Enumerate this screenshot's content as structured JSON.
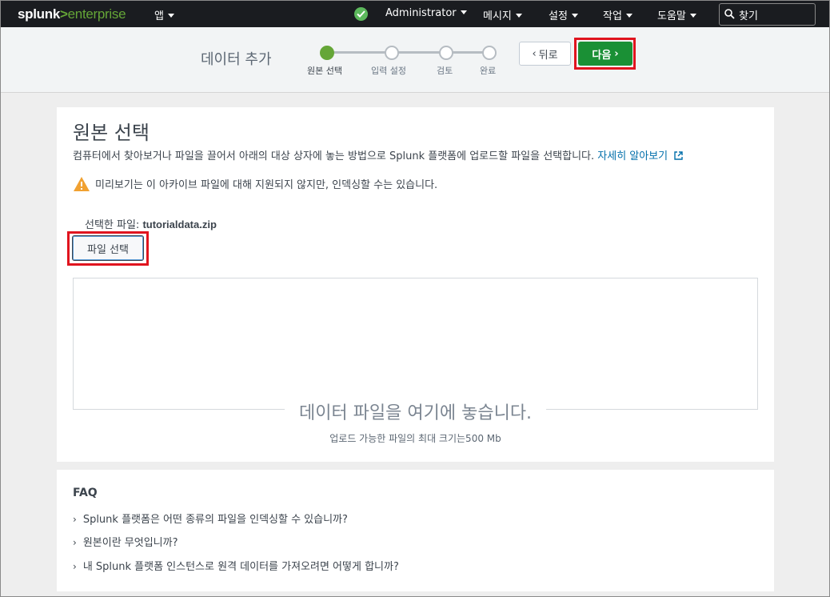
{
  "topbar": {
    "logo_part1": "splunk",
    "logo_part2": ">",
    "logo_part3": "enterprise",
    "apps_label": "앱",
    "user_label": "Administrator",
    "messages_label": "메시지",
    "settings_label": "설정",
    "activity_label": "작업",
    "help_label": "도움말",
    "search_label": "찾기"
  },
  "wizard": {
    "title": "데이터 추가",
    "steps": [
      {
        "label": "원본 선택",
        "active": true
      },
      {
        "label": "입력 설정",
        "active": false
      },
      {
        "label": "검토",
        "active": false
      },
      {
        "label": "완료",
        "active": false
      }
    ],
    "back_label": "뒤로",
    "next_label": "다음"
  },
  "main": {
    "title": "원본 선택",
    "description": "컴퓨터에서 찾아보거나 파일을 끌어서 아래의 대상 상자에 놓는 방법으로 Splunk 플랫폼에 업로드할 파일을 선택합니다.",
    "learn_more": "자세히 알아보기",
    "warning": "미리보기는 이 아카이브 파일에 대해 지원되지 않지만, 인덱싱할 수는 있습니다.",
    "selected_file_label": "선택한 파일:",
    "selected_file_name": "tutorialdata.zip",
    "select_file_button": "파일 선택",
    "drop_text": "데이터 파일을 여기에 놓습니다.",
    "drop_subtext": "업로드 가능한 파일의 최대 크기는500 Mb"
  },
  "faq": {
    "title": "FAQ",
    "items": [
      "Splunk 플랫폼은 어떤 종류의 파일을 인덱싱할 수 있습니까?",
      "원본이란 무엇입니까?",
      "내 Splunk 플랫폼 인스턴스로 원격 데이터를 가져오려면 어떻게 합니까?"
    ]
  },
  "colors": {
    "topbar_bg": "#1a1c20",
    "brand_green": "#65a637",
    "next_button": "#1a9035",
    "link": "#006eaa",
    "highlight_box": "#e0141e",
    "warning": "#f1a131"
  }
}
